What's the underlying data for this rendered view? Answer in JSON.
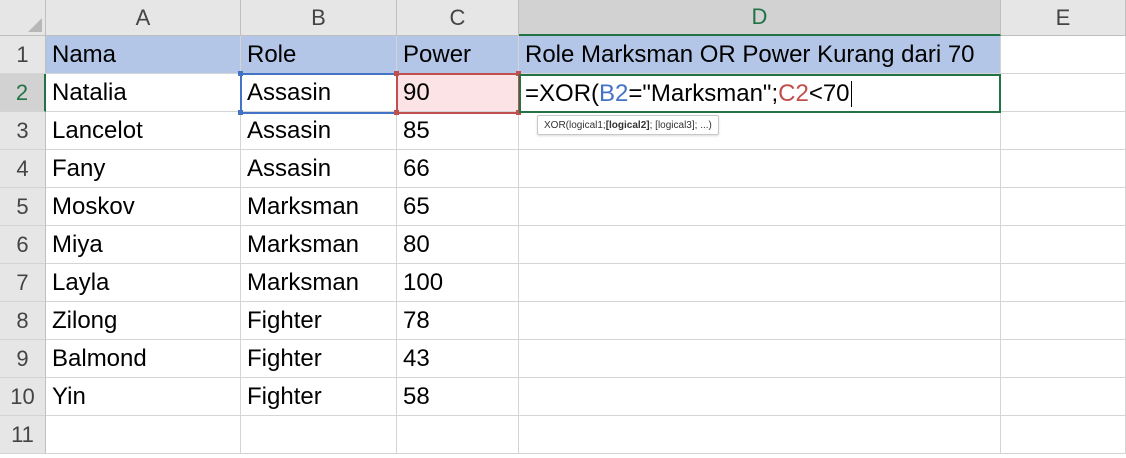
{
  "columns": [
    "A",
    "B",
    "C",
    "D",
    "E"
  ],
  "active_column": "D",
  "rows": [
    "1",
    "2",
    "3",
    "4",
    "5",
    "6",
    "7",
    "8",
    "9",
    "10",
    "11"
  ],
  "active_row": "2",
  "header_row": {
    "a": "Nama",
    "b": "Role",
    "c": "Power",
    "d": "Role Marksman OR Power Kurang dari 70"
  },
  "data_rows": [
    {
      "name": "Natalia",
      "role": "Assasin",
      "power": "90"
    },
    {
      "name": "Lancelot",
      "role": "Assasin",
      "power": "85"
    },
    {
      "name": "Fany",
      "role": "Assasin",
      "power": "66"
    },
    {
      "name": "Moskov",
      "role": "Marksman",
      "power": "65"
    },
    {
      "name": "Miya",
      "role": "Marksman",
      "power": "80"
    },
    {
      "name": "Layla",
      "role": "Marksman",
      "power": "100"
    },
    {
      "name": "Zilong",
      "role": "Fighter",
      "power": "78"
    },
    {
      "name": "Balmond",
      "role": "Fighter",
      "power": "43"
    },
    {
      "name": "Yin",
      "role": "Fighter",
      "power": "58"
    }
  ],
  "formula": {
    "prefix": "=XOR(",
    "ref1": "B2",
    "middle": "=\"Marksman\";",
    "ref2": "C2",
    "suffix": "<70"
  },
  "tooltip": {
    "start": "XOR(logical1; ",
    "bold": "[logical2]",
    "end": "; [logical3]; ...)"
  },
  "colors": {
    "header_fill": "#b4c6e7",
    "ref_b2": "#4472c4",
    "ref_c2": "#c0504d",
    "active_border": "#217346"
  }
}
